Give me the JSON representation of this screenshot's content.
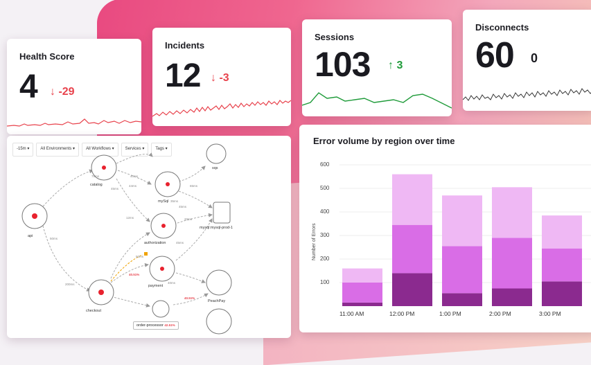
{
  "colors": {
    "accent_down": "#e8424c",
    "accent_up": "#1f9b3a",
    "bar_light": "#efb8f4",
    "bar_mid": "#d96de6",
    "bar_dark": "#8b2a8f",
    "node_red": "#e8222e"
  },
  "cards": {
    "health": {
      "label": "Health Score",
      "value": "4",
      "delta": "-29",
      "delta_icon": "arrow-down-icon"
    },
    "incidents": {
      "label": "Incidents",
      "value": "12",
      "delta": "-3",
      "delta_icon": "arrow-down-icon"
    },
    "sessions": {
      "label": "Sessions",
      "value": "103",
      "delta": "3",
      "delta_icon": "arrow-up-icon"
    },
    "disconnects": {
      "label": "Disconnects",
      "value": "60",
      "delta": "0"
    }
  },
  "map": {
    "filters": [
      "-15m ▾",
      "All Environments ▾",
      "All Workflows ▾",
      "Services ▾",
      "Tags ▾"
    ],
    "nodes": {
      "api": "api",
      "catalog": "catalog",
      "mysql": "mySql",
      "authorization": "authorization",
      "payment": "payment",
      "checkout": "checkout",
      "order_processor": "order-processor",
      "peachpay": "PeachPay",
      "mysql_prod": "mysql:mysql-prod-1",
      "sqs": "sqs"
    },
    "edges": {
      "e1": "50ms",
      "e2": "75ms",
      "e3": "45ms",
      "e4": "44ms",
      "e5": "40ms",
      "e6": "12ms",
      "e7": "35ms",
      "e8": "65ms",
      "e9": "20ms",
      "e10": "45ms",
      "e11": "40ms",
      "e12": "200ms",
      "e13": "50ms",
      "e14": "45ms",
      "err1": "40.51%",
      "err2": "40.51%",
      "err3": "42.51%"
    }
  },
  "chart_data": {
    "type": "bar",
    "title": "Error volume by region over time",
    "ylabel": "Number of Errors",
    "xlabel": "",
    "ylim": [
      0,
      600
    ],
    "yticks": [
      100,
      200,
      300,
      400,
      500,
      600
    ],
    "categories": [
      "11:00 AM",
      "12:00 PM",
      "1:00 PM",
      "2:00 PM",
      "3:00 PM"
    ],
    "stacked": true,
    "series": [
      {
        "values": [
          15,
          140,
          55,
          75,
          105
        ]
      },
      {
        "values": [
          85,
          205,
          200,
          215,
          140
        ]
      },
      {
        "values": [
          60,
          215,
          215,
          215,
          140
        ]
      }
    ]
  }
}
